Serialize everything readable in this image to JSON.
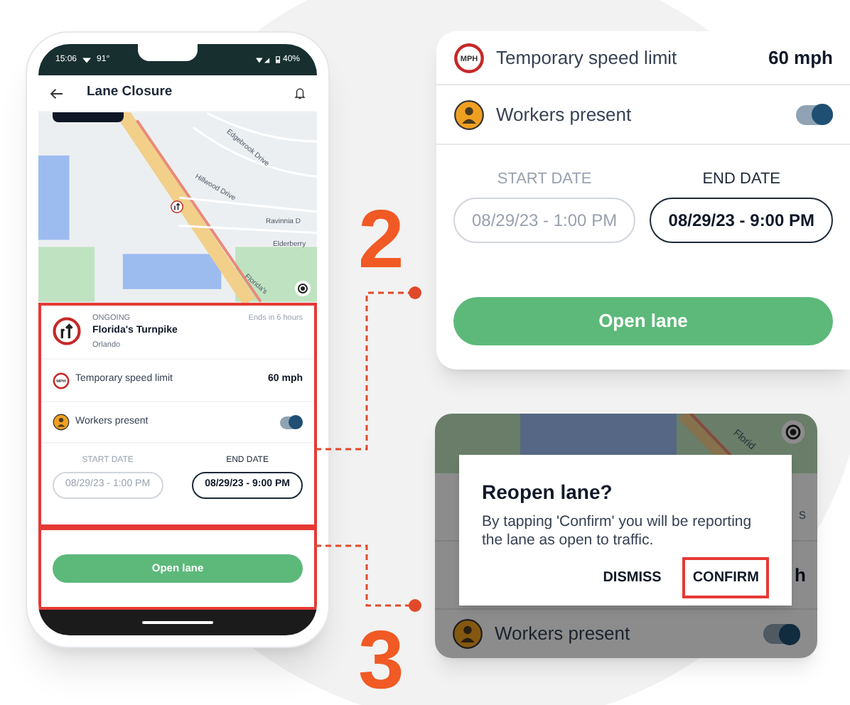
{
  "phone": {
    "status_bar": {
      "time": "15:06",
      "temperature": "91°",
      "battery": "40%"
    },
    "app_bar": {
      "title": "Lane Closure"
    },
    "map": {
      "labels": [
        "Edgebrook Drive",
        "Hillwood Drive",
        "Ravinnia D",
        "Elderberry",
        "Florida's"
      ]
    },
    "closure": {
      "status": "ONGOING",
      "road": "Florida's Turnpike",
      "city": "Orlando",
      "ends": "Ends in 6 hours"
    },
    "speed_limit": {
      "icon_text": "MPH",
      "label": "Temporary speed limit",
      "value": "60 mph"
    },
    "workers": {
      "label": "Workers present",
      "on": true
    },
    "dates": [
      {
        "label": "START DATE",
        "value": "08/29/23 - 1:00 PM",
        "selected": false
      },
      {
        "label": "END DATE",
        "value": "08/29/23 - 9:00 PM",
        "selected": true
      }
    ],
    "button": "Open lane"
  },
  "callout_2": {
    "number": "2",
    "speed_limit": {
      "icon_text": "MPH",
      "label": "Temporary speed limit",
      "value": "60 mph"
    },
    "workers": {
      "label": "Workers present",
      "on": true
    },
    "dates": [
      {
        "label": "START DATE",
        "value": "08/29/23 - 1:00 PM",
        "selected": false
      },
      {
        "label": "END DATE",
        "value": "08/29/23 - 9:00 PM",
        "selected": true
      }
    ],
    "button": "Open lane"
  },
  "callout_3": {
    "number": "3",
    "map_label": "Florid",
    "hidden_fragments": [
      "s",
      "h"
    ],
    "workers": {
      "label": "Workers present",
      "on": true
    },
    "dialog": {
      "title": "Reopen lane?",
      "body": "By tapping 'Confirm' you will be reporting the lane as open to traffic.",
      "buttons": [
        {
          "label": "DISMISS",
          "highlighted": false
        },
        {
          "label": "CONFIRM",
          "highlighted": true
        }
      ]
    }
  }
}
